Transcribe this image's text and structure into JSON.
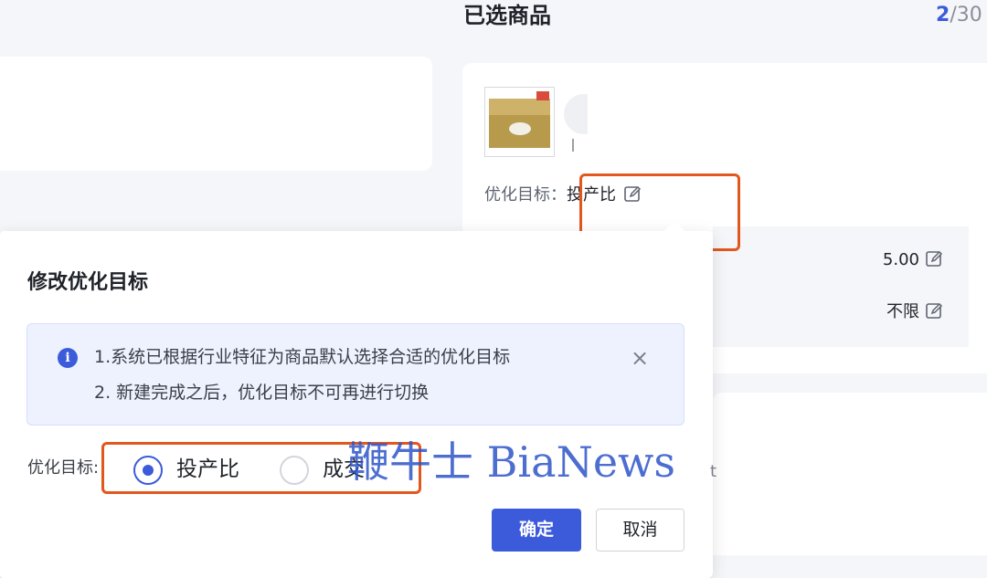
{
  "selected_panel": {
    "title": "已选商品",
    "count_current": "2",
    "count_rest": "/30"
  },
  "product": {
    "optimization_label": "优化目标：",
    "optimization_value": "投产比",
    "metrics": [
      {
        "value": "5.00"
      },
      {
        "value": "不限"
      }
    ]
  },
  "popover": {
    "title": "修改优化目标",
    "info_lines": [
      "1.系统已根据行业特征为商品默认选择合适的优化目标",
      "2. 新建完成之后，优化目标不可再进行切换"
    ],
    "info_icon": "i",
    "close_glyph": "×",
    "radio_label": "优化目标:",
    "options": [
      {
        "label": "投产比",
        "checked": true
      },
      {
        "label": "成交",
        "checked": false
      }
    ],
    "confirm_label": "确定",
    "cancel_label": "取消"
  },
  "watermark": "鞭牛士 BiaNews",
  "stray_glyph": "t",
  "colors": {
    "accent": "#3b5bdb",
    "highlight": "#e2571e"
  }
}
